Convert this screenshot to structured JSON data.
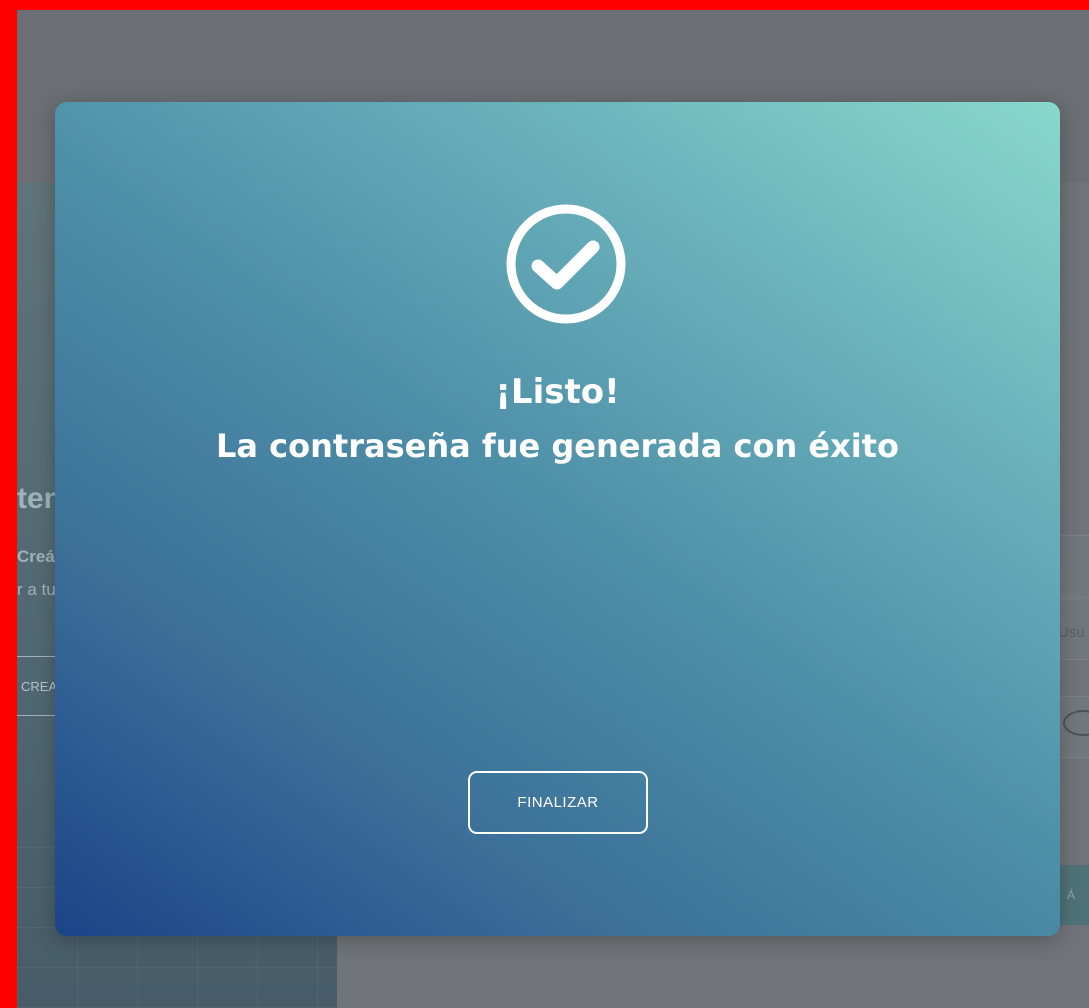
{
  "background": {
    "left_title": "ten",
    "left_subtitle": "Creá",
    "left_text": "r a tu",
    "left_button": "CREA",
    "right_label": "Usu",
    "right_button": "Á"
  },
  "modal": {
    "icon": "check-circle-icon",
    "title": "¡Listo!",
    "message": "La contraseña fue generada con éxito",
    "finalize_label": "FINALIZAR",
    "gradient_start": "#1a4488",
    "gradient_end": "#88d8cd"
  }
}
